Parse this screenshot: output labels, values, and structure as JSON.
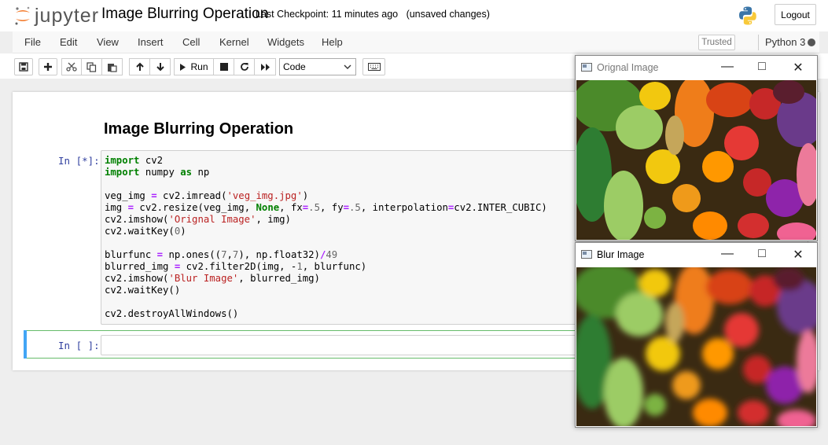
{
  "header": {
    "logo_text": "jupyter",
    "notebook_title": "Image Blurring Operation",
    "checkpoint": "Last Checkpoint: 11 minutes ago",
    "unsaved": "(unsaved changes)",
    "logout_label": "Logout"
  },
  "menu": {
    "items": [
      "File",
      "Edit",
      "View",
      "Insert",
      "Cell",
      "Kernel",
      "Widgets",
      "Help"
    ],
    "trusted": "Trusted",
    "kernel_name": "Python 3"
  },
  "toolbar": {
    "run_label": "Run",
    "cell_type": "Code",
    "icons": [
      "save-icon",
      "plus-icon",
      "cut-icon",
      "copy-icon",
      "paste-icon",
      "arrow-up-icon",
      "arrow-down-icon",
      "run-icon",
      "stop-icon",
      "restart-icon",
      "fast-forward-icon",
      "keyboard-icon"
    ]
  },
  "notebook": {
    "markdown_heading": "Image Blurring Operation",
    "cell1_prompt": "In [*]:",
    "cell2_prompt": "In [ ]:",
    "code_lines": [
      "import cv2",
      "import numpy as np",
      "",
      "veg_img = cv2.imread('veg_img.jpg')",
      "img = cv2.resize(veg_img, None, fx=.5, fy=.5, interpolation=cv2.INTER_CUBIC)",
      "cv2.imshow('Orignal Image', img)",
      "cv2.waitKey(0)",
      "",
      "blurfunc = np.ones((7,7), np.float32)/49",
      "blurred_img = cv2.filter2D(img, -1, blurfunc)",
      "cv2.imshow('Blur Image', blurred_img)",
      "cv2.waitKey()",
      "",
      "cv2.destroyAllWindows()"
    ]
  },
  "windows": {
    "original_title": "Orignal Image",
    "blur_title": "Blur Image"
  },
  "colors": {
    "prompt": "#303f9f",
    "keyword": "#008000",
    "string": "#ba2121",
    "active_cell": "#42a5f5"
  }
}
